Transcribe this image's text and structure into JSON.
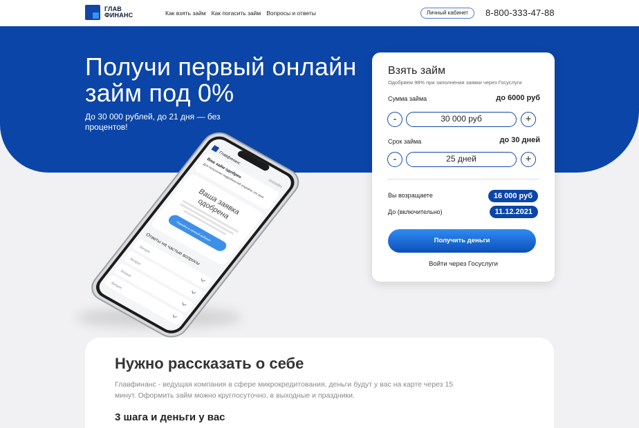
{
  "header": {
    "logo_line1": "ГЛАВ",
    "logo_line2": "ФИНАНС",
    "nav": [
      "Как взять займ",
      "Как погасить займ",
      "Вопросы и ответы"
    ],
    "cabinet_label": "Личный кабинет",
    "phone": "8-800-333-47-88"
  },
  "hero": {
    "title": "Получи первый онлайн займ под 0%",
    "subtitle": "До 30 000 рублей, до 21 дня — без процентов!"
  },
  "phone_mock": {
    "brand": "Главфинанс",
    "link": "ОНЛАЙН",
    "approved_title": "Ваш займ одобрен",
    "approved_sub": "Для получения подробностей откройте это окно",
    "headline_1": "Ваша заявка",
    "headline_2": "одобрена",
    "text": "Сумму займа, способы получения и другую информацию вы можете посмотреть в вашем личном кабинете",
    "button": "Перейти в личный кабинет",
    "faq_title": "Ответы на частые вопросы",
    "faq_items": [
      "Вопрос",
      "Вопрос",
      "Вопрос",
      "Вопрос"
    ]
  },
  "loan_card": {
    "title": "Взять займ",
    "note": "Одобряем 98% при заполнении заявки через Госуслуги",
    "amount_label": "Сумма займа",
    "amount_max": "до 6000 руб",
    "amount_value": "30 000 руб",
    "term_label": "Срок займа",
    "term_max": "до 30 дней",
    "term_value": "25 дней",
    "minus": "-",
    "plus": "+",
    "return_label": "Вы возращаете",
    "return_value": "16 000 руб",
    "until_label": "До (включительно)",
    "until_value": "11.12.2021",
    "cta": "Получить деньги",
    "gos_link": "Войти через Госуслуги"
  },
  "about": {
    "title": "Нужно рассказать о себе",
    "text": "Главфинанс - ведущая компания в сфере микрокредитования, деньги будут у вас на карте через 15 минут. Оформить займ можно круглосуточно, в выходные и праздники.",
    "steps_title": "3 шага и деньги у вас"
  },
  "colors": {
    "brand_blue": "#0b45a8",
    "accent_blue": "#2f8cf2"
  }
}
